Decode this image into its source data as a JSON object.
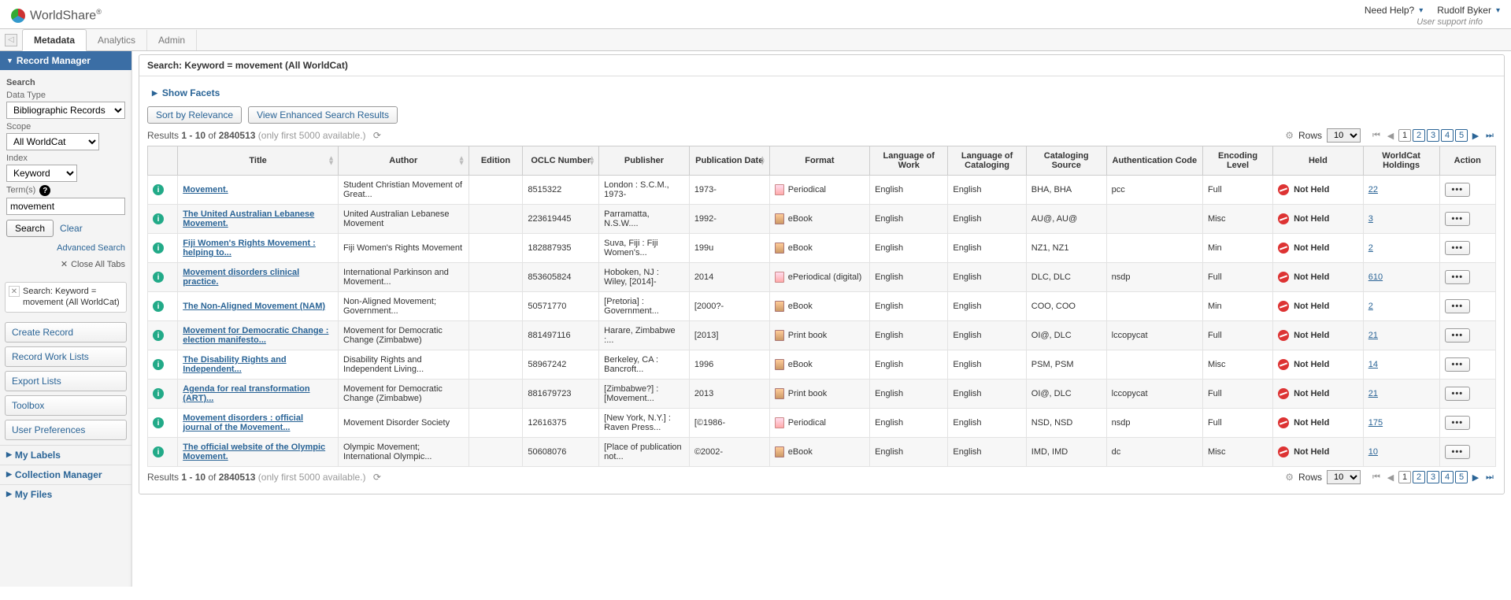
{
  "brand": "WorldShare",
  "brand_reg": "®",
  "top": {
    "help": "Need Help?",
    "user": "Rudolf Byker",
    "support": "User support info"
  },
  "tabs": [
    "Metadata",
    "Analytics",
    "Admin"
  ],
  "active_tab": 0,
  "sidebar": {
    "record_manager": "Record Manager",
    "search_label": "Search",
    "data_type_label": "Data Type",
    "data_type_value": "Bibliographic Records",
    "scope_label": "Scope",
    "scope_value": "All WorldCat",
    "index_label": "Index",
    "index_value": "Keyword",
    "terms_label": "Term(s)",
    "terms_value": "movement",
    "search_btn": "Search",
    "clear_btn": "Clear",
    "advanced": "Advanced Search",
    "close_tabs": "Close All Tabs",
    "open_search": "Search: Keyword = movement (All WorldCat)",
    "btns": [
      "Create Record",
      "Record Work Lists",
      "Export Lists",
      "Toolbox",
      "User Preferences"
    ],
    "sections": [
      "My Labels",
      "Collection Manager",
      "My Files"
    ]
  },
  "main": {
    "title": "Search: Keyword = movement (All WorldCat)",
    "show_facets": "Show Facets",
    "sort_btn": "Sort by Relevance",
    "enhanced_btn": "View Enhanced Search Results",
    "results_prefix": "Results ",
    "results_range": "1 - 10",
    "results_of": " of ",
    "results_total": "2840513",
    "results_note": " (only first 5000 available.)",
    "rows_label": "Rows",
    "rows_value": "10",
    "pages": [
      "1",
      "2",
      "3",
      "4",
      "5"
    ],
    "columns": [
      "",
      "Title",
      "Author",
      "Edition",
      "OCLC Number",
      "Publisher",
      "Publication Date",
      "Format",
      "Language of Work",
      "Language of Cataloging",
      "Cataloging Source",
      "Authentication Code",
      "Encoding Level",
      "Held",
      "WorldCat Holdings",
      "Action"
    ],
    "not_held": "Not Held",
    "rows": [
      {
        "title": "Movement.",
        "author": "Student Christian Movement of Great...",
        "oclc": "8515322",
        "pub": "London : S.C.M., 1973-",
        "pdate": "1973-",
        "fmt": "Periodical",
        "fmti": "per",
        "lw": "English",
        "lc": "English",
        "src": "BHA, BHA",
        "auth": "pcc",
        "enc": "Full",
        "hold": "22"
      },
      {
        "title": "The United Australian Lebanese Movement.",
        "author": "United Australian Lebanese Movement",
        "oclc": "223619445",
        "pub": "Parramatta, N.S.W....",
        "pdate": "1992-",
        "fmt": "eBook",
        "fmti": "e",
        "lw": "English",
        "lc": "English",
        "src": "AU@, AU@",
        "auth": "",
        "enc": "Misc",
        "hold": "3"
      },
      {
        "title": "Fiji Women's Rights Movement : helping to...",
        "author": "Fiji Women's Rights Movement",
        "oclc": "182887935",
        "pub": "Suva, Fiji : Fiji Women's...",
        "pdate": "199u",
        "fmt": "eBook",
        "fmti": "e",
        "lw": "English",
        "lc": "English",
        "src": "NZ1, NZ1",
        "auth": "",
        "enc": "Min",
        "hold": "2"
      },
      {
        "title": "Movement disorders clinical practice.",
        "author": "International Parkinson and Movement...",
        "oclc": "853605824",
        "pub": "Hoboken, NJ : Wiley, [2014]-",
        "pdate": "2014",
        "fmt": "ePeriodical (digital)",
        "fmti": "per",
        "lw": "English",
        "lc": "English",
        "src": "DLC, DLC",
        "auth": "nsdp",
        "enc": "Full",
        "hold": "610"
      },
      {
        "title": "The Non-Aligned Movement (NAM)",
        "author": "Non-Aligned Movement; Government...",
        "oclc": "50571770",
        "pub": "[Pretoria] : Government...",
        "pdate": "[2000?-",
        "fmt": "eBook",
        "fmti": "e",
        "lw": "English",
        "lc": "English",
        "src": "COO, COO",
        "auth": "",
        "enc": "Min",
        "hold": "2"
      },
      {
        "title": "Movement for Democratic Change : election manifesto...",
        "author": "Movement for Democratic Change (Zimbabwe)",
        "oclc": "881497116",
        "pub": "Harare, Zimbabwe :...",
        "pdate": "[2013]",
        "fmt": "Print book",
        "fmti": "b",
        "lw": "English",
        "lc": "English",
        "src": "OI@, DLC",
        "auth": "lccopycat",
        "enc": "Full",
        "hold": "21"
      },
      {
        "title": "The Disability Rights and Independent...",
        "author": "Disability Rights and Independent Living...",
        "oclc": "58967242",
        "pub": "Berkeley, CA : Bancroft...",
        "pdate": "1996",
        "fmt": "eBook",
        "fmti": "e",
        "lw": "English",
        "lc": "English",
        "src": "PSM, PSM",
        "auth": "",
        "enc": "Misc",
        "hold": "14"
      },
      {
        "title": "Agenda for real transformation (ART)...",
        "author": "Movement for Democratic Change (Zimbabwe)",
        "oclc": "881679723",
        "pub": "[Zimbabwe?] : [Movement...",
        "pdate": "2013",
        "fmt": "Print book",
        "fmti": "b",
        "lw": "English",
        "lc": "English",
        "src": "OI@, DLC",
        "auth": "lccopycat",
        "enc": "Full",
        "hold": "21"
      },
      {
        "title": "Movement disorders : official journal of the Movement...",
        "author": "Movement Disorder Society",
        "oclc": "12616375",
        "pub": "[New York, N.Y.] : Raven Press...",
        "pdate": "[©1986-",
        "fmt": "Periodical",
        "fmti": "per",
        "lw": "English",
        "lc": "English",
        "src": "NSD, NSD",
        "auth": "nsdp",
        "enc": "Full",
        "hold": "175"
      },
      {
        "title": "The official website of the Olympic Movement.",
        "author": "Olympic Movement; International Olympic...",
        "oclc": "50608076",
        "pub": "[Place of publication not...",
        "pdate": "©2002-",
        "fmt": "eBook",
        "fmti": "e",
        "lw": "English",
        "lc": "English",
        "src": "IMD, IMD",
        "auth": "dc",
        "enc": "Misc",
        "hold": "10"
      }
    ]
  }
}
